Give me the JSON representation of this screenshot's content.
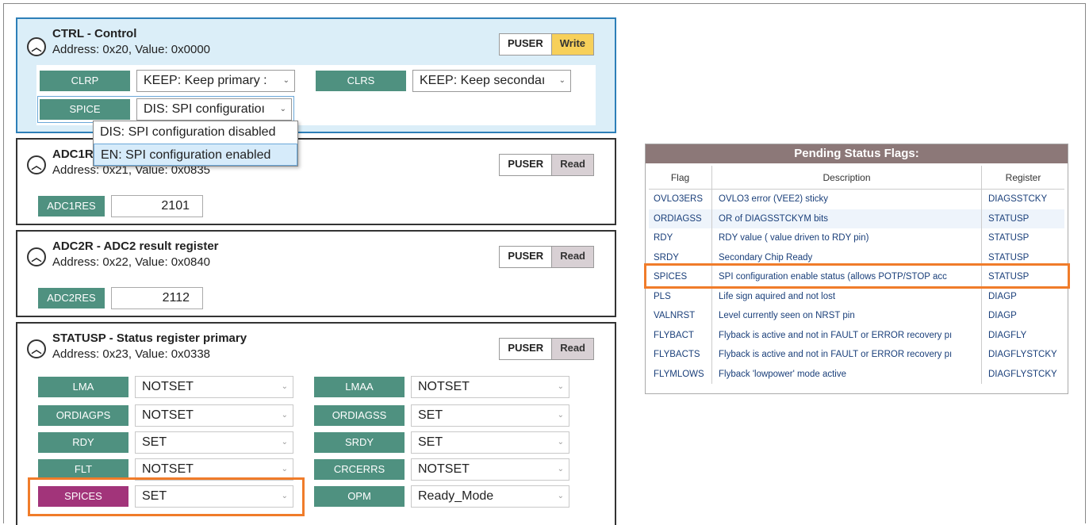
{
  "panels": {
    "ctrl": {
      "title": "CTRL - Control",
      "address": "Address: 0x20, Value: 0x0000",
      "btn1": "PUSER",
      "btn2": "Write",
      "fields": {
        "clrp": {
          "label": "CLRP",
          "value": "KEEP: Keep primary :"
        },
        "clrs": {
          "label": "CLRS",
          "value": "KEEP: Keep secondaı"
        },
        "spice": {
          "label": "SPICE",
          "value": "DIS: SPI configuratioı"
        }
      },
      "dropdown": [
        "DIS: SPI configuration disabled",
        "EN: SPI configuration enabled"
      ]
    },
    "adc1r": {
      "title": "ADC1R",
      "address": "Address: 0x21, Value: 0x0835",
      "btn1": "PUSER",
      "btn2": "Read",
      "field_label": "ADC1RES",
      "field_value": "2101"
    },
    "adc2r": {
      "title": "ADC2R - ADC2 result register",
      "address": "Address: 0x22, Value: 0x0840",
      "btn1": "PUSER",
      "btn2": "Read",
      "field_label": "ADC2RES",
      "field_value": "2112"
    },
    "statusp": {
      "title": "STATUSP - Status register primary",
      "address": "Address: 0x23, Value: 0x0338",
      "btn1": "PUSER",
      "btn2": "Read",
      "fields": [
        {
          "label": "LMA",
          "value": "NOTSET"
        },
        {
          "label": "LMAA",
          "value": "NOTSET"
        },
        {
          "label": "ORDIAGPS",
          "value": "NOTSET"
        },
        {
          "label": "ORDIAGSS",
          "value": "SET"
        },
        {
          "label": "RDY",
          "value": "SET"
        },
        {
          "label": "SRDY",
          "value": "SET"
        },
        {
          "label": "FLT",
          "value": "NOTSET"
        },
        {
          "label": "CRCERRS",
          "value": "NOTSET"
        },
        {
          "label": "SPICES",
          "value": "SET"
        },
        {
          "label": "OPM",
          "value": "Ready_Mode"
        }
      ]
    }
  },
  "pending": {
    "title": "Pending Status Flags:",
    "headers": [
      "Flag",
      "Description",
      "Register"
    ],
    "rows": [
      [
        "OVLO3ERS",
        "OVLO3 error (VEE2) sticky",
        "DIAGSSTCKY"
      ],
      [
        "ORDIAGSS",
        "OR of DIAGSSTCKYM bits",
        "STATUSP"
      ],
      [
        "RDY",
        "RDY value ( value driven to RDY pin)",
        "STATUSP"
      ],
      [
        "SRDY",
        "Secondary Chip Ready",
        "STATUSP"
      ],
      [
        "SPICES",
        "SPI configuration enable status (allows POTP/STOP acc",
        "STATUSP"
      ],
      [
        "PLS",
        "Life sign aquired and not lost",
        "DIAGP"
      ],
      [
        "VALNRST",
        "Level currently seen on NRST pin",
        "DIAGP"
      ],
      [
        "FLYBACT",
        "Flyback is active and not in FAULT or ERROR recovery pı",
        "DIAGFLY"
      ],
      [
        "FLYBACTS",
        "Flyback is active and not in FAULT or ERROR recovery pı",
        "DIAGFLYSTCKY"
      ],
      [
        "FLYMLOWS",
        "Flyback 'lowpower' mode active",
        "DIAGFLYSTCKY"
      ]
    ]
  },
  "colors": {
    "label_green": "#4f9180",
    "label_magenta": "#a2347a",
    "highlight_orange": "#f07c2a",
    "write_yellow": "#f7d05a",
    "selected_panel_blue": "#dbeef8"
  }
}
